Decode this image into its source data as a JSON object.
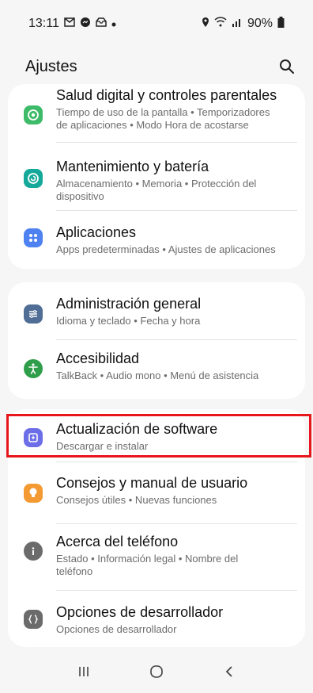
{
  "status_bar": {
    "time": "13:11",
    "notification_icons": [
      "mail-icon",
      "messenger-icon",
      "inbox-icon",
      "dot-icon"
    ],
    "battery": "90%",
    "right_icons": [
      "location-icon",
      "wifi-icon",
      "signal-icon",
      "battery-icon"
    ]
  },
  "header": {
    "title": "Ajustes"
  },
  "groups": [
    {
      "items": [
        {
          "title": "Salud digital y controles parentales",
          "subtitle_lines": [
            "Tiempo de uso de la pantalla • Temporizadores",
            "de aplicaciones • Modo Hora de acostarse"
          ],
          "icon": "digital-wellbeing-icon",
          "color": "#3dbb69"
        },
        {
          "title": "Mantenimiento y batería",
          "subtitle_lines": [
            "Almacenamiento • Memoria • Protección del",
            "dispositivo"
          ],
          "icon": "device-care-icon",
          "color": "#14a99a"
        },
        {
          "title": "Aplicaciones",
          "subtitle_lines": [
            "Apps predeterminadas • Ajustes de aplicaciones"
          ],
          "icon": "apps-icon",
          "color": "#4d82f0"
        }
      ]
    },
    {
      "items": [
        {
          "title": "Administración general",
          "subtitle_lines": [
            "Idioma y teclado • Fecha y hora"
          ],
          "icon": "general-management-icon",
          "color": "#4f6d95"
        },
        {
          "title": "Accesibilidad",
          "subtitle_lines": [
            "TalkBack • Audio mono • Menú de asistencia"
          ],
          "icon": "accessibility-icon",
          "color": "#2f9e4a"
        }
      ]
    },
    {
      "items": [
        {
          "title": "Actualización de software",
          "subtitle_lines": [
            "Descargar e instalar"
          ],
          "icon": "software-update-icon",
          "color": "#6c6ee8"
        },
        {
          "title": "Consejos y manual de usuario",
          "subtitle_lines": [
            "Consejos útiles • Nuevas funciones"
          ],
          "icon": "tips-icon",
          "color": "#f39a32"
        },
        {
          "title": "Acerca del teléfono",
          "subtitle_lines": [
            "Estado • Información legal • Nombre del",
            "teléfono"
          ],
          "icon": "info-icon",
          "color": "#6b6b6b"
        },
        {
          "title": "Opciones de desarrollador",
          "subtitle_lines": [
            "Opciones de desarrollador"
          ],
          "icon": "developer-options-icon",
          "color": "#6b6b6b"
        }
      ]
    }
  ],
  "highlight_color": "#e8161c",
  "nav": [
    "recents-icon",
    "home-icon",
    "back-icon"
  ]
}
